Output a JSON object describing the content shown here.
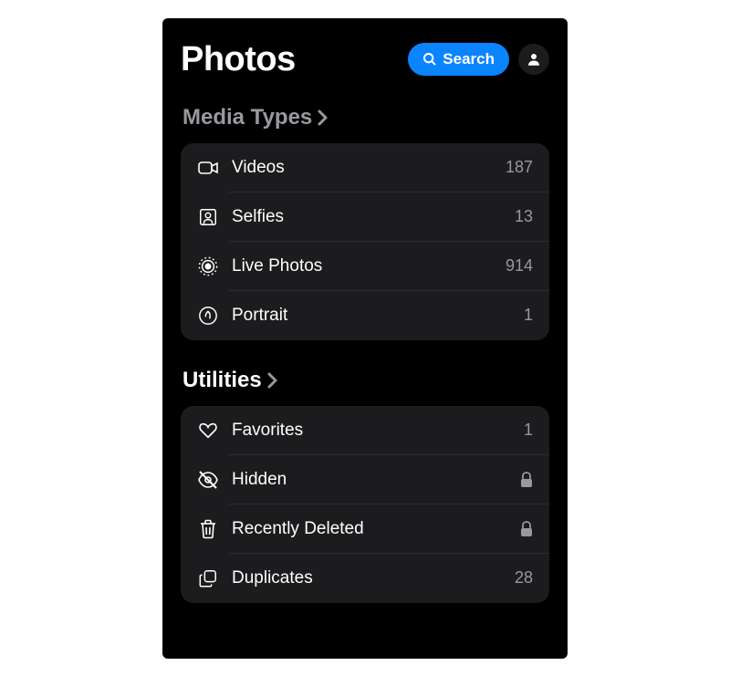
{
  "header": {
    "title": "Photos",
    "search_label": "Search"
  },
  "sections": {
    "media_types": {
      "title": "Media Types",
      "items": [
        {
          "label": "Videos",
          "value": "187"
        },
        {
          "label": "Selfies",
          "value": "13"
        },
        {
          "label": "Live Photos",
          "value": "914"
        },
        {
          "label": "Portrait",
          "value": "1"
        }
      ]
    },
    "utilities": {
      "title": "Utilities",
      "items": [
        {
          "label": "Favorites",
          "value": "1"
        },
        {
          "label": "Hidden"
        },
        {
          "label": "Recently Deleted"
        },
        {
          "label": "Duplicates",
          "value": "28"
        }
      ]
    }
  }
}
